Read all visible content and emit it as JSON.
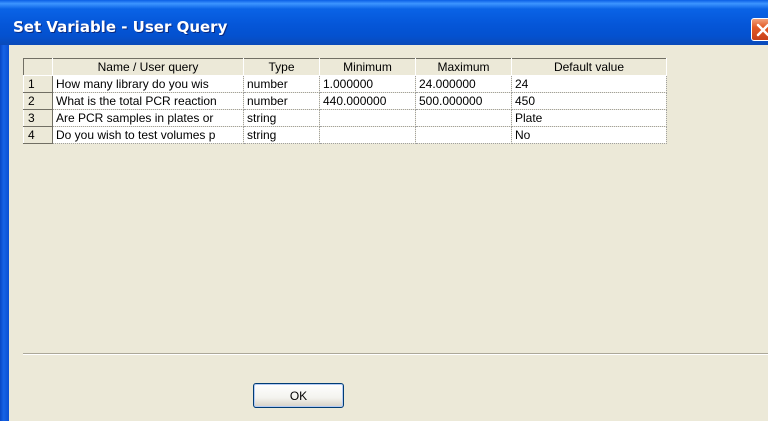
{
  "window": {
    "title": "Set Variable - User Query",
    "close_icon": "close-icon",
    "accent_color": "#0556d8",
    "close_color": "#e35a25"
  },
  "grid": {
    "columns": [
      "Name / User query",
      "Type",
      "Minimum",
      "Maximum",
      "Default value"
    ],
    "rows": [
      {
        "num": "1",
        "name": "How many library do you wis",
        "type": "number",
        "min": "1.000000",
        "max": "24.000000",
        "default": "24"
      },
      {
        "num": "2",
        "name": "What is the total PCR reaction",
        "type": "number",
        "min": "440.000000",
        "max": "500.000000",
        "default": "450"
      },
      {
        "num": "3",
        "name": "Are PCR samples in plates or",
        "type": "string",
        "min": "",
        "max": "",
        "default": "Plate"
      },
      {
        "num": "4",
        "name": "Do you wish to test volumes p",
        "type": "string",
        "min": "",
        "max": "",
        "default": "No"
      }
    ]
  },
  "buttons": {
    "ok_label": "OK"
  }
}
